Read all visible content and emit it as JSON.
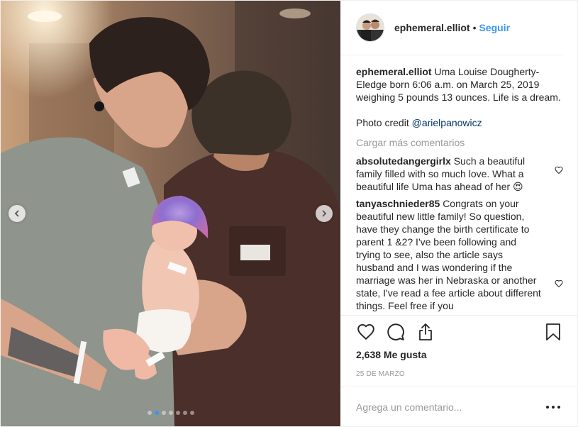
{
  "header": {
    "username": "ephemeral.elliot",
    "separator": "•",
    "follow_label": "Seguir"
  },
  "caption": {
    "username": "ephemeral.elliot",
    "text": "Uma Louise Dougherty-Eledge born 6:06 a.m. on March 25, 2019 weighing 5 pounds 13 ounces. Life is a dream.",
    "credit_prefix": "Photo credit ",
    "credit_mention": "@arielpanowicz"
  },
  "load_more_label": "Cargar más comentarios",
  "comments": [
    {
      "username": "absolutedangergirlx",
      "text": "Such a beautiful family filled with so much love. What a beautiful life Uma has ahead of her 😍"
    },
    {
      "username": "tanyaschnieder85",
      "text": "Congrats on your beautiful new little family! So question, have they change the birth certificate to parent 1 &2? I've been following and trying to see, also the article says husband and I was wondering if the marriage was her in Nebraska or another state, I've read a fee article about different things. Feel free if you"
    }
  ],
  "likes_label": "2,638 Me gusta",
  "date_label": "25 DE MARZO",
  "add_comment": {
    "placeholder": "Agrega un comentario..."
  },
  "carousel": {
    "total": 7,
    "current": 2
  },
  "icons": {
    "prev": "chevron-left-icon",
    "next": "chevron-right-icon",
    "like": "heart-icon",
    "comment": "comment-bubble-icon",
    "share": "share-icon",
    "save": "bookmark-icon",
    "more": "more-options-icon"
  },
  "colors": {
    "accent": "#3897f0",
    "text": "#262626",
    "muted": "#999999",
    "border": "#efefef"
  }
}
